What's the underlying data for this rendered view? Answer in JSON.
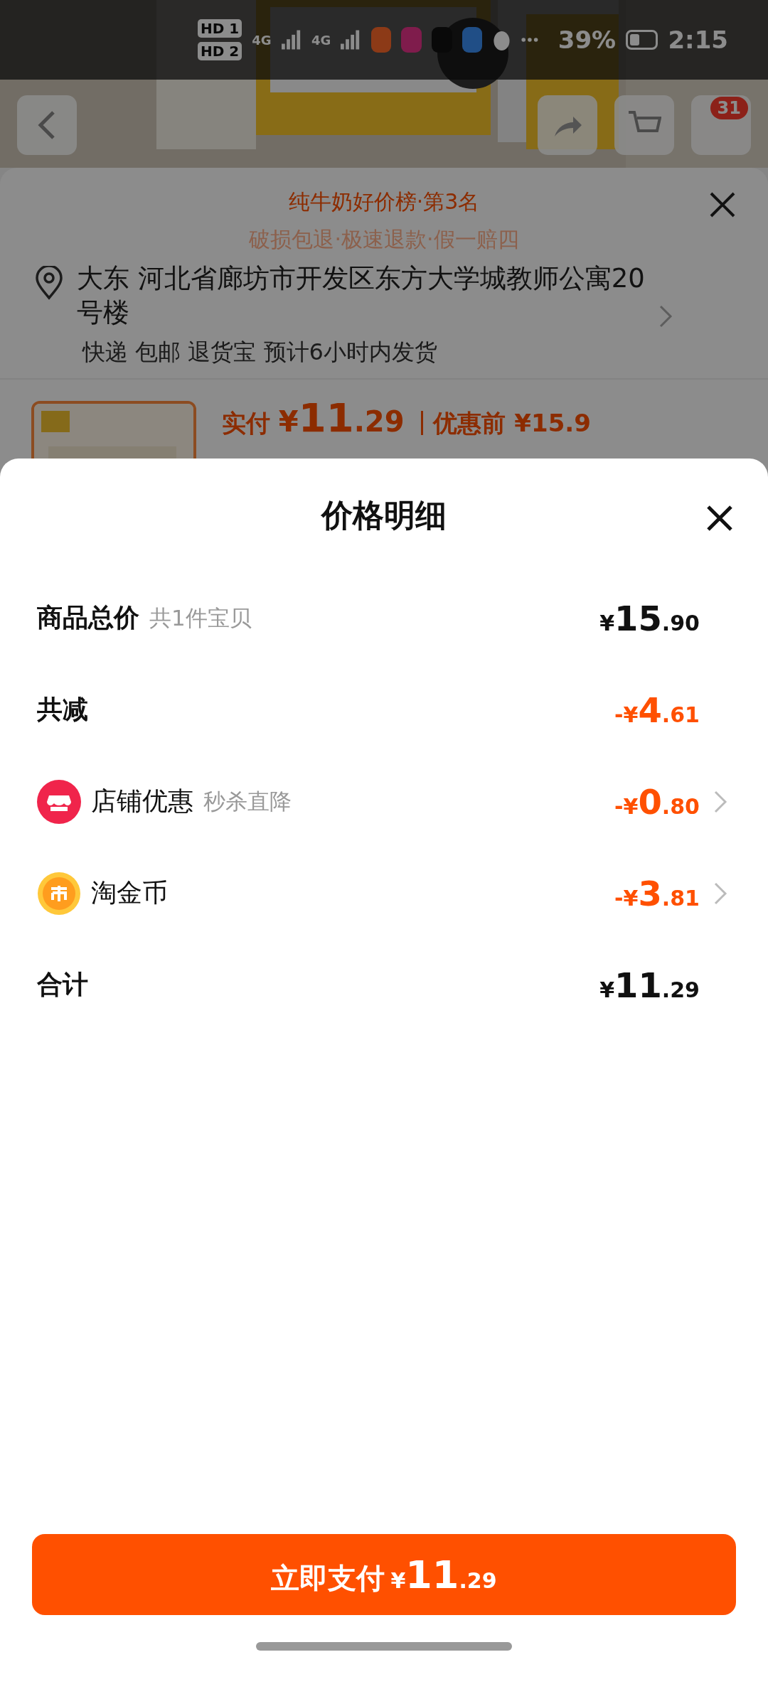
{
  "status_bar": {
    "sims": [
      {
        "label": "HD",
        "slot": "1"
      },
      {
        "label": "HD",
        "slot": "2"
      }
    ],
    "networks": [
      "4G",
      "4G"
    ],
    "battery": "39%",
    "time": "2:15"
  },
  "product_header": {
    "cart_badge": "31"
  },
  "order_sheet": {
    "rank": "纯牛奶好价榜·第3名",
    "promise": "破损包退·极速退款·假一赔四",
    "address": {
      "name": "大东",
      "text": "河北省廊坊市开发区东方大学城教师公寓20号楼"
    },
    "shipping": [
      "快递",
      "包邮",
      "退货宝",
      "预计6小时内发货"
    ],
    "price": {
      "paid_label": "实付",
      "paid_amount": "¥11.29",
      "before": "优惠前 ¥15.9"
    }
  },
  "price_detail": {
    "title": "价格明细",
    "rows": [
      {
        "kind": "heading",
        "label": "商品总价",
        "note": "共1件宝贝",
        "amount": "¥15.90",
        "discount": false,
        "chevron": false
      },
      {
        "kind": "heading",
        "label": "共减",
        "amount": "-¥4.61",
        "discount": true,
        "chevron": false
      },
      {
        "kind": "shop",
        "label": "店铺优惠",
        "note": "秒杀直降",
        "amount": "-¥0.80",
        "discount": true,
        "chevron": true
      },
      {
        "kind": "coin",
        "label": "淘金币",
        "amount": "-¥3.81",
        "discount": true,
        "chevron": true
      },
      {
        "kind": "heading",
        "label": "合计",
        "amount": "¥11.29",
        "discount": false,
        "chevron": false
      }
    ],
    "pay_button": {
      "label": "立即支付",
      "amount": "¥11.29"
    }
  }
}
